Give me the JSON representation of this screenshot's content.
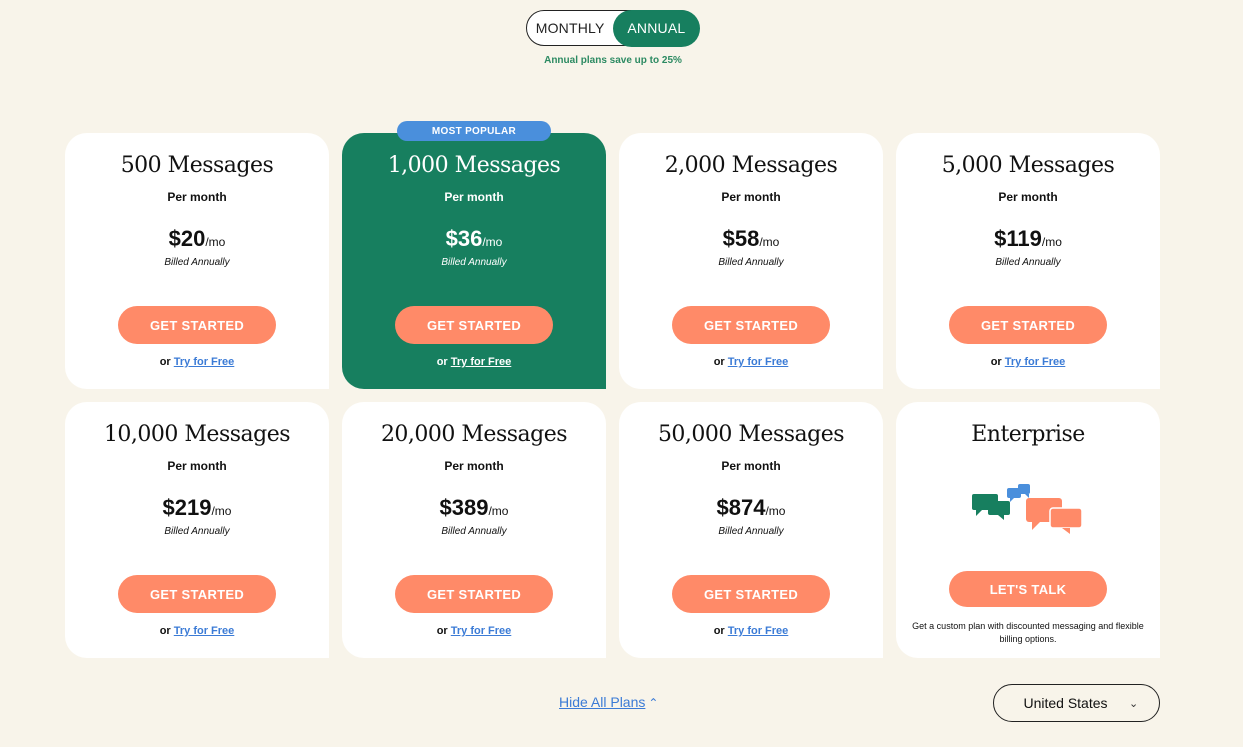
{
  "billing_toggle": {
    "monthly": "MONTHLY",
    "annual": "ANNUAL",
    "selected": "annual"
  },
  "save_note": "Annual plans save up to 25%",
  "popular_badge": "MOST POPULAR",
  "common": {
    "period": "Per month",
    "unit": "/mo",
    "billed": "Billed Annually",
    "cta": "GET STARTED",
    "or": "or",
    "try": "Try for Free"
  },
  "plans": [
    {
      "name": "500 Messages",
      "price": "$20"
    },
    {
      "name": "1,000 Messages",
      "price": "$36"
    },
    {
      "name": "2,000 Messages",
      "price": "$58"
    },
    {
      "name": "5,000 Messages",
      "price": "$119"
    },
    {
      "name": "10,000 Messages",
      "price": "$219"
    },
    {
      "name": "20,000 Messages",
      "price": "$389"
    },
    {
      "name": "50,000 Messages",
      "price": "$874"
    }
  ],
  "enterprise": {
    "name": "Enterprise",
    "cta": "LET'S TALK",
    "desc": "Get a custom plan with discounted messaging and flexible billing options."
  },
  "hide_plans": "Hide All Plans",
  "country": "United States",
  "colors": {
    "green": "#177f5f",
    "orange": "#ff8a68",
    "blue": "#4a8fdc",
    "bg": "#f8f4ea"
  }
}
